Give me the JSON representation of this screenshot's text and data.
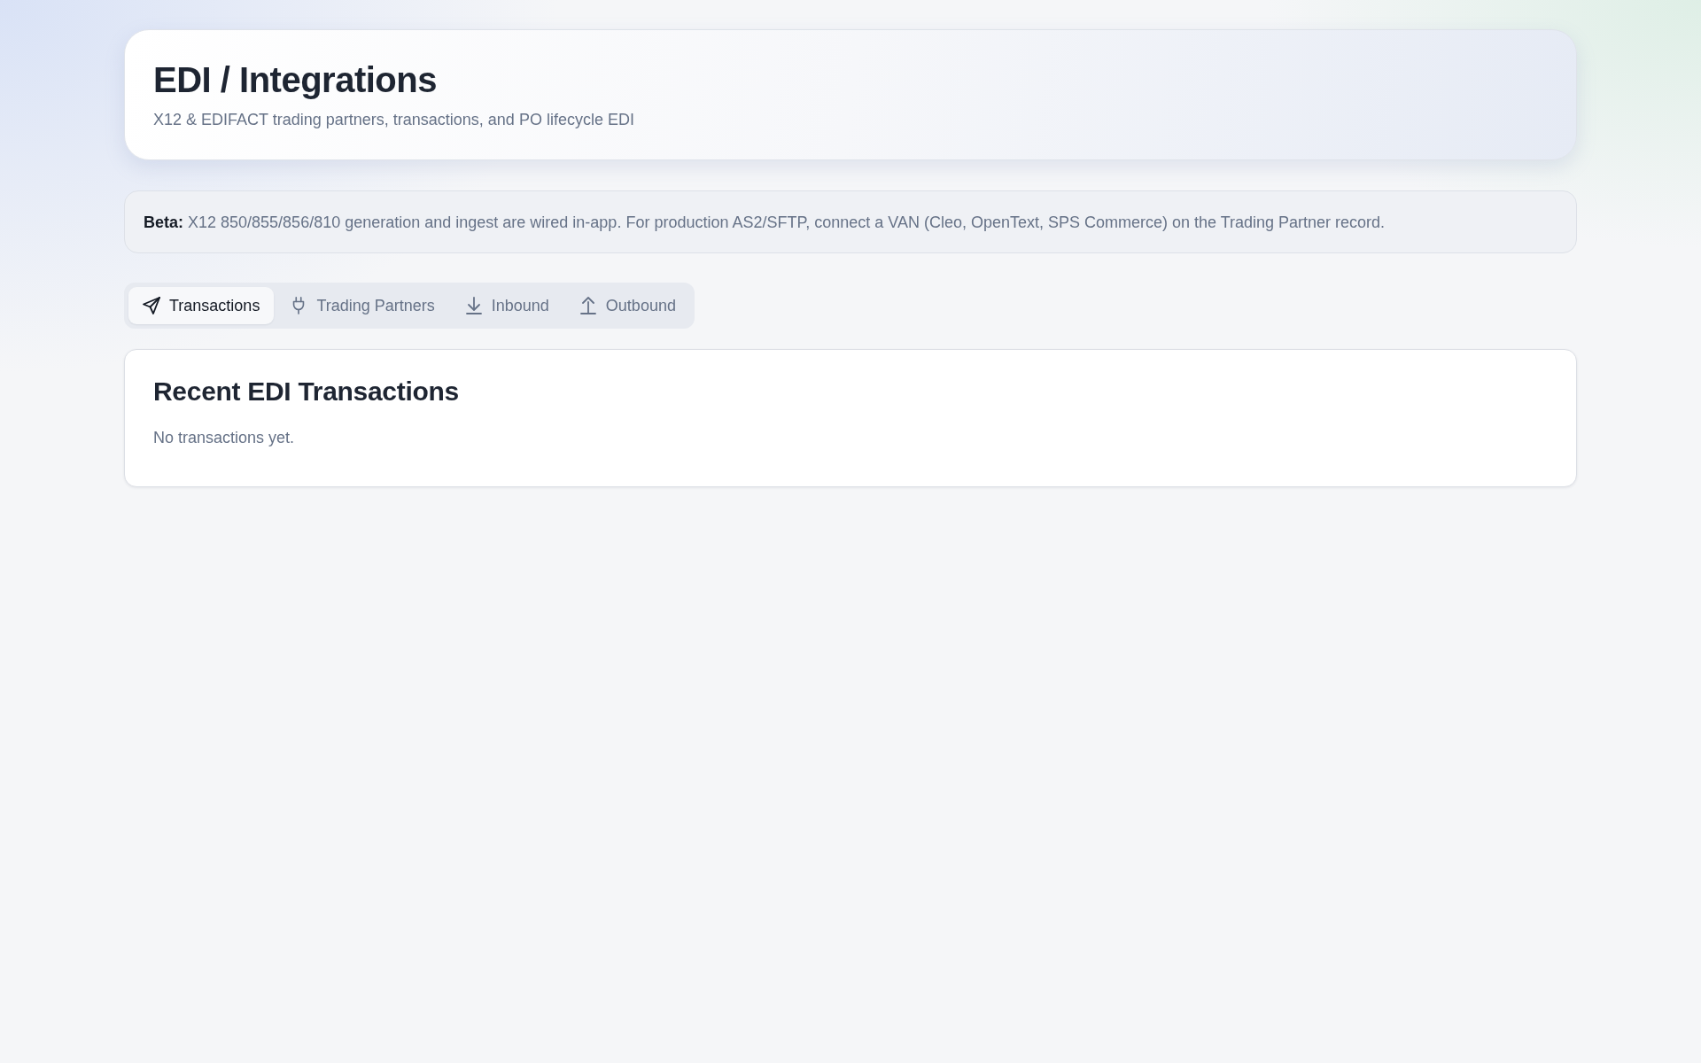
{
  "header": {
    "title": "EDI / Integrations",
    "subtitle": "X12 & EDIFACT trading partners, transactions, and PO lifecycle EDI"
  },
  "notice": {
    "text": "**Beta:** X12 850/855/856/810 generation and ingest are wired in-app. For production AS2/SFTP, connect a VAN (Cleo, OpenText, SPS Commerce) on the Trading Partner record."
  },
  "tabs": [
    {
      "label": "Transactions",
      "selected": true
    },
    {
      "label": "Trading Partners",
      "selected": false
    },
    {
      "label": "Inbound",
      "selected": false
    },
    {
      "label": "Outbound",
      "selected": false
    }
  ],
  "panel": {
    "title": "Recent EDI Transactions",
    "empty_message": "No transactions yet."
  }
}
